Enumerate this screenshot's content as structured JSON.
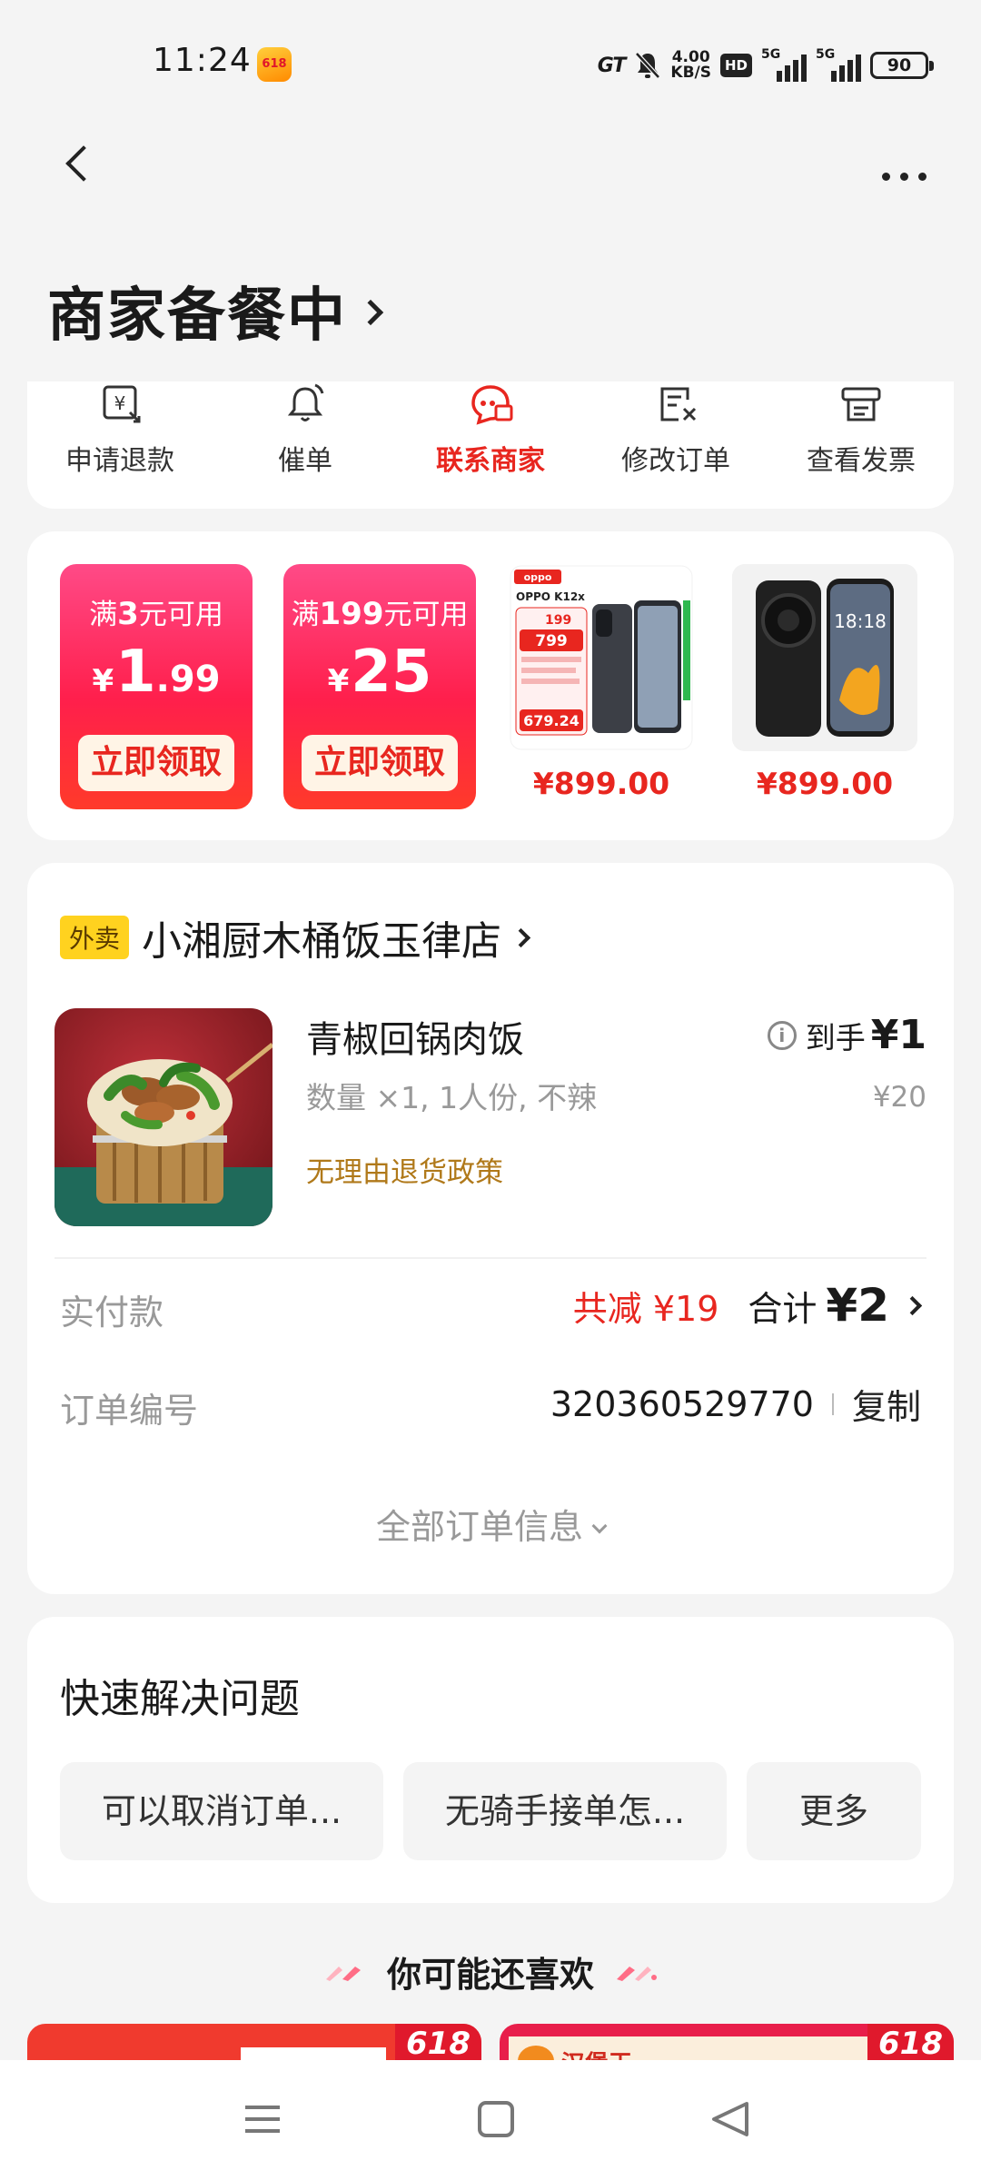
{
  "status_bar": {
    "time": "11:24",
    "app_badge": "618",
    "network_speed_value": "4.00",
    "network_speed_unit": "KB/S",
    "hd_label": "HD",
    "signal1_label": "5G",
    "signal2_label": "5G",
    "battery": "90"
  },
  "header": {
    "status_title": "商家备餐中"
  },
  "actions": [
    {
      "label": "申请退款",
      "icon": "refund-icon"
    },
    {
      "label": "催单",
      "icon": "bell-icon"
    },
    {
      "label": "联系商家",
      "icon": "merchant-chat-icon",
      "active": true
    },
    {
      "label": "修改订单",
      "icon": "edit-order-icon"
    },
    {
      "label": "查看发票",
      "icon": "invoice-icon"
    }
  ],
  "promo": {
    "coupons": [
      {
        "cond_prefix": "满",
        "cond_amount": "3",
        "cond_suffix": "元可用",
        "currency": "¥",
        "amount_int": "1",
        "amount_dec": ".99",
        "claim": "立即领取"
      },
      {
        "cond_prefix": "满",
        "cond_amount": "199",
        "cond_suffix": "元可用",
        "currency": "¥",
        "amount_int": "25",
        "amount_dec": "",
        "claim": "立即领取"
      }
    ],
    "products": [
      {
        "price": "¥899.00",
        "image": "phone-ad-image",
        "ad_brand": "oppo",
        "ad_model": "OPPO K12x",
        "ad_prices": [
          "199",
          "799",
          "679.24"
        ]
      },
      {
        "price": "¥899.00",
        "image": "phone-image",
        "screen_time": "18:18"
      }
    ]
  },
  "order": {
    "tag": "外卖",
    "shop_name": "小湘厨木桶饭玉律店",
    "dish": {
      "name": "青椒回锅肉饭",
      "spec": "数量 ×1, 1人份, 不辣",
      "policy": "无理由退货政策",
      "final_label": "到手",
      "final_price": "¥1",
      "original_price": "¥20"
    },
    "paid_label": "实付款",
    "discount": "共减 ¥19",
    "total_label": "合计",
    "total": "¥2",
    "order_no_label": "订单编号",
    "order_no": "320360529770",
    "copy": "复制",
    "all_info": "全部订单信息"
  },
  "quick": {
    "title": "快速解决问题",
    "buttons": [
      "可以取消订单...",
      "无骑手接单怎...",
      "更多"
    ]
  },
  "recommend": {
    "title": "你可能还喜欢",
    "badge": "618",
    "items": [
      {
        "tag": ""
      },
      {
        "tag": "汉堡王"
      }
    ]
  },
  "colors": {
    "accent_red": "#e8261f",
    "policy_brown": "#b0791a",
    "waimai_yellow": "#ffd21f",
    "page_bg": "#f4f4f4"
  }
}
